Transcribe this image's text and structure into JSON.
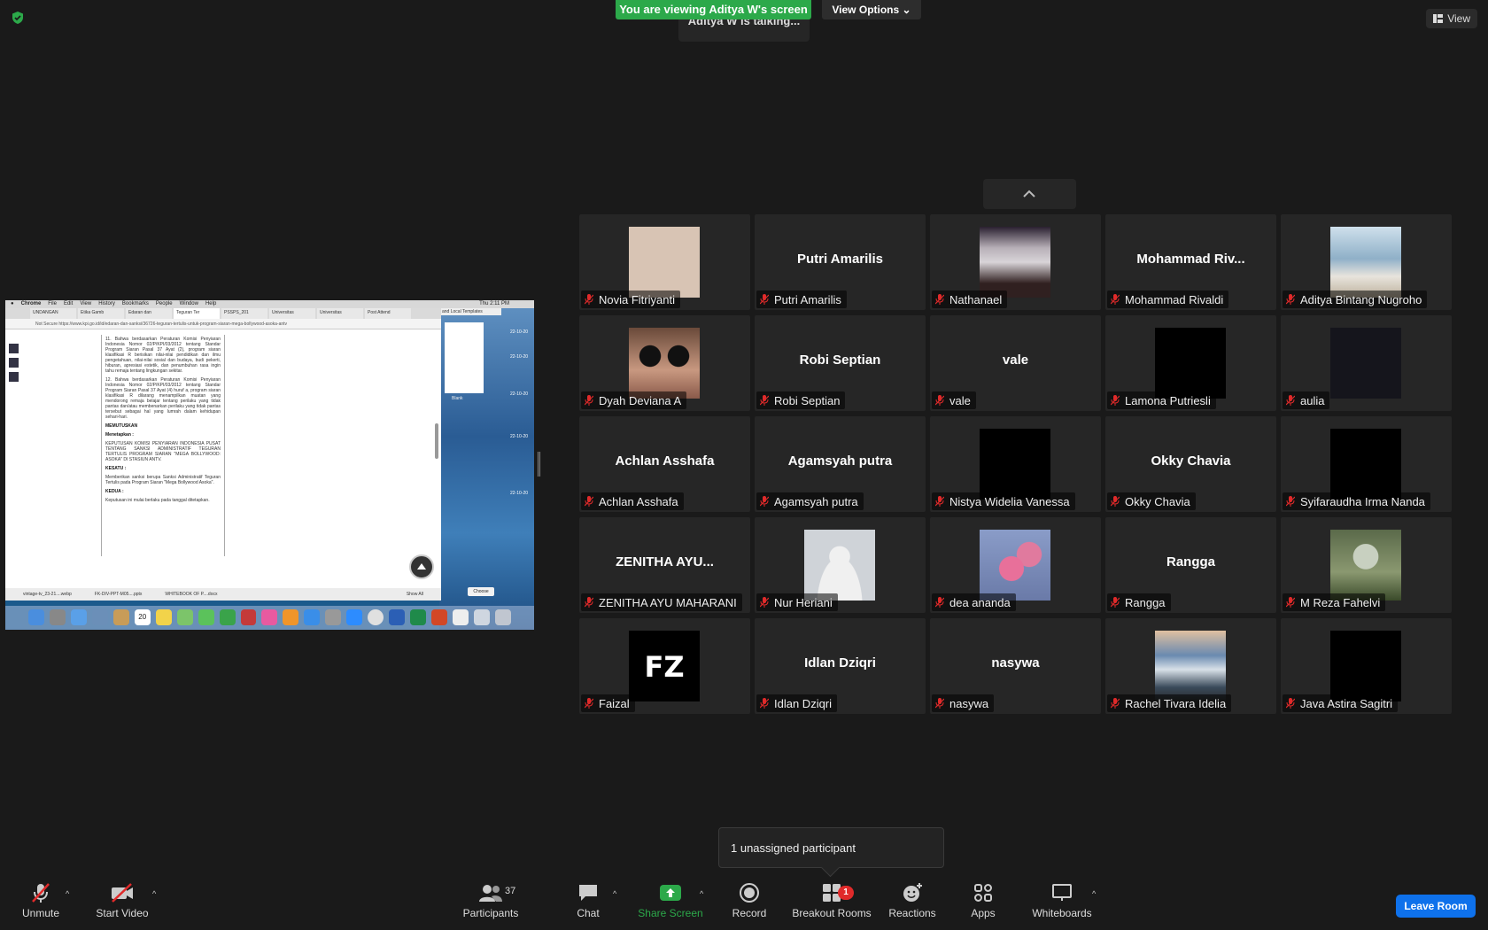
{
  "banner": {
    "viewing_text": "You are viewing Aditya W's screen",
    "view_options_label": "View Options",
    "talking_text": "Aditya W is talking...",
    "view_label": "View"
  },
  "shared_screen": {
    "mac_menu": [
      "Chrome",
      "File",
      "Edit",
      "View",
      "History",
      "Bookmarks",
      "People",
      "Window",
      "Help"
    ],
    "clock": "Thu 2:11 PM",
    "tabs": [
      "UNDANGAN",
      "Etika Gamb",
      "Edaran dan",
      "Teguran Ter",
      "PSSPS_201",
      "Universitas",
      "Universitas",
      "Post Attend"
    ],
    "url": "Not Secure   https://www.kpi.go.id/id/edaran-dan-sanksi/36726-teguran-tertulis-untuk-program-siaran-mega-bollywood-asoka-antv",
    "paragraph_11": "11. Bahwa berdasarkan Peraturan Komisi Penyiaran Indonesia Nomor 02/P/KPI/03/2012 tentang Standar Program Siaran Pasal 37 Ayat (2), program siaran klasifikasi R berisikan nilai-nilai pendidikan dan ilmu pengetahuan, nilai-nilai sosial dan budaya, budi pekerti, hiburan, apresiasi estetik, dan penumbuhan rasa ingin tahu remaja tentang lingkungan sekitar.",
    "paragraph_12": "12. Bahwa berdasarkan Peraturan Komisi Penyiaran Indonesia Nomor 02/P/KPI/03/2012 tentang Standar Program Siaran Pasal 37 Ayat (4) huruf a, program siaran klasifikasi R dilarang menampilkan muatan yang mendorong remaja belajar tentang perilaku yang tidak pantas dan/atau membenarkan perilaku yang tidak pantas tersebut sebagai hal yang lumrah dalam kehidupan sehari-hari.",
    "memutuskan": "MEMUTUSKAN",
    "menetapkan": "Menetapkan :",
    "keputusan": "KEPUTUSAN KOMISI PENYIARAN INDONESIA PUSAT TENTANG SANKSI ADMINISTRATIF TEGURAN TERTULIS PROGRAM SIARAN \"MEGA BOLLYWOOD: ASOKA\" DI STASIUN ANTV.",
    "kesatu": "KESATU :",
    "kesatu_text": "Memberikan sanksi berupa Sanksi Administratif Teguran Tertulis pada Program Siaran \"Mega Bollywood Asoka\".",
    "kedua": "KEDUA :",
    "kedua_text": "Keputusan ini mulai berlaku pada tanggal ditetapkan.",
    "downloads": [
      "vintage-tv_23-21....webp",
      "FK-DIV-PPT-M05....pptx",
      "WHITEBOOK OF P....docx"
    ],
    "show_all": "Show All",
    "choose_label": "Choose",
    "blank_label": "Blank",
    "templates_label": "and Local Templates",
    "dates": [
      "22-10-20",
      "22-10-20",
      "22-10-20",
      "22-10-20",
      "22-10-20"
    ],
    "dock_date": "20"
  },
  "participants_tiles": [
    {
      "display": "",
      "label": "Novia Fitriyanti",
      "img": "beige"
    },
    {
      "display": "Putri Amarilis",
      "label": "Putri Amarilis",
      "img": ""
    },
    {
      "display": "",
      "label": "Nathanael",
      "img": "van"
    },
    {
      "display": "Mohammad  Riv...",
      "label": "Mohammad Rivaldi",
      "img": ""
    },
    {
      "display": "",
      "label": "Aditya Bintang Nugroho",
      "img": "beach"
    },
    {
      "display": "",
      "label": "Dyah Deviana A",
      "img": "face"
    },
    {
      "display": "Robi Septian",
      "label": "Robi Septian",
      "img": ""
    },
    {
      "display": "vale",
      "label": "vale",
      "img": ""
    },
    {
      "display": "",
      "label": "Lamona Putriesli",
      "img": "black"
    },
    {
      "display": "",
      "label": "aulia",
      "img": "dark"
    },
    {
      "display": "Achlan Asshafa",
      "label": "Achlan Asshafa",
      "img": ""
    },
    {
      "display": "Agamsyah putra",
      "label": "Agamsyah putra",
      "img": ""
    },
    {
      "display": "",
      "label": "Nistya Widelia Vanessa",
      "img": "black"
    },
    {
      "display": "Okky Chavia",
      "label": "Okky Chavia",
      "img": ""
    },
    {
      "display": "",
      "label": "Syifaraudha Irma Nanda",
      "img": "black"
    },
    {
      "display": "ZENITHA AYU...",
      "label": "ZENITHA AYU MAHARANI",
      "img": ""
    },
    {
      "display": "",
      "label": "Nur Heriani",
      "img": "silhouette"
    },
    {
      "display": "",
      "label": "dea ananda",
      "img": "flower"
    },
    {
      "display": "Rangga",
      "label": "Rangga",
      "img": ""
    },
    {
      "display": "",
      "label": "M Reza Fahelvi",
      "img": "statue"
    },
    {
      "display": "",
      "label": "Faizal",
      "img": "fz"
    },
    {
      "display": "Idlan Dziqri",
      "label": "Idlan Dziqri",
      "img": ""
    },
    {
      "display": "nasywa",
      "label": "nasywa",
      "img": ""
    },
    {
      "display": "",
      "label": "Rachel Tivara Idelia",
      "img": "sea"
    },
    {
      "display": "",
      "label": "Java Astira Sagitri",
      "img": "black"
    }
  ],
  "fz_logo_text": "FZ",
  "toast": {
    "text": "1 unassigned participant"
  },
  "toolbar": {
    "unmute": "Unmute",
    "start_video": "Start Video",
    "participants": "Participants",
    "participants_count": "37",
    "chat": "Chat",
    "share_screen": "Share Screen",
    "record": "Record",
    "breakout_rooms": "Breakout Rooms",
    "breakout_badge": "1",
    "reactions": "Reactions",
    "apps": "Apps",
    "whiteboards": "Whiteboards",
    "leave_room": "Leave Room"
  },
  "colors": {
    "accent_green": "#2ca94a",
    "leave_blue": "#0e71eb",
    "mute_red": "#e02a2a"
  }
}
